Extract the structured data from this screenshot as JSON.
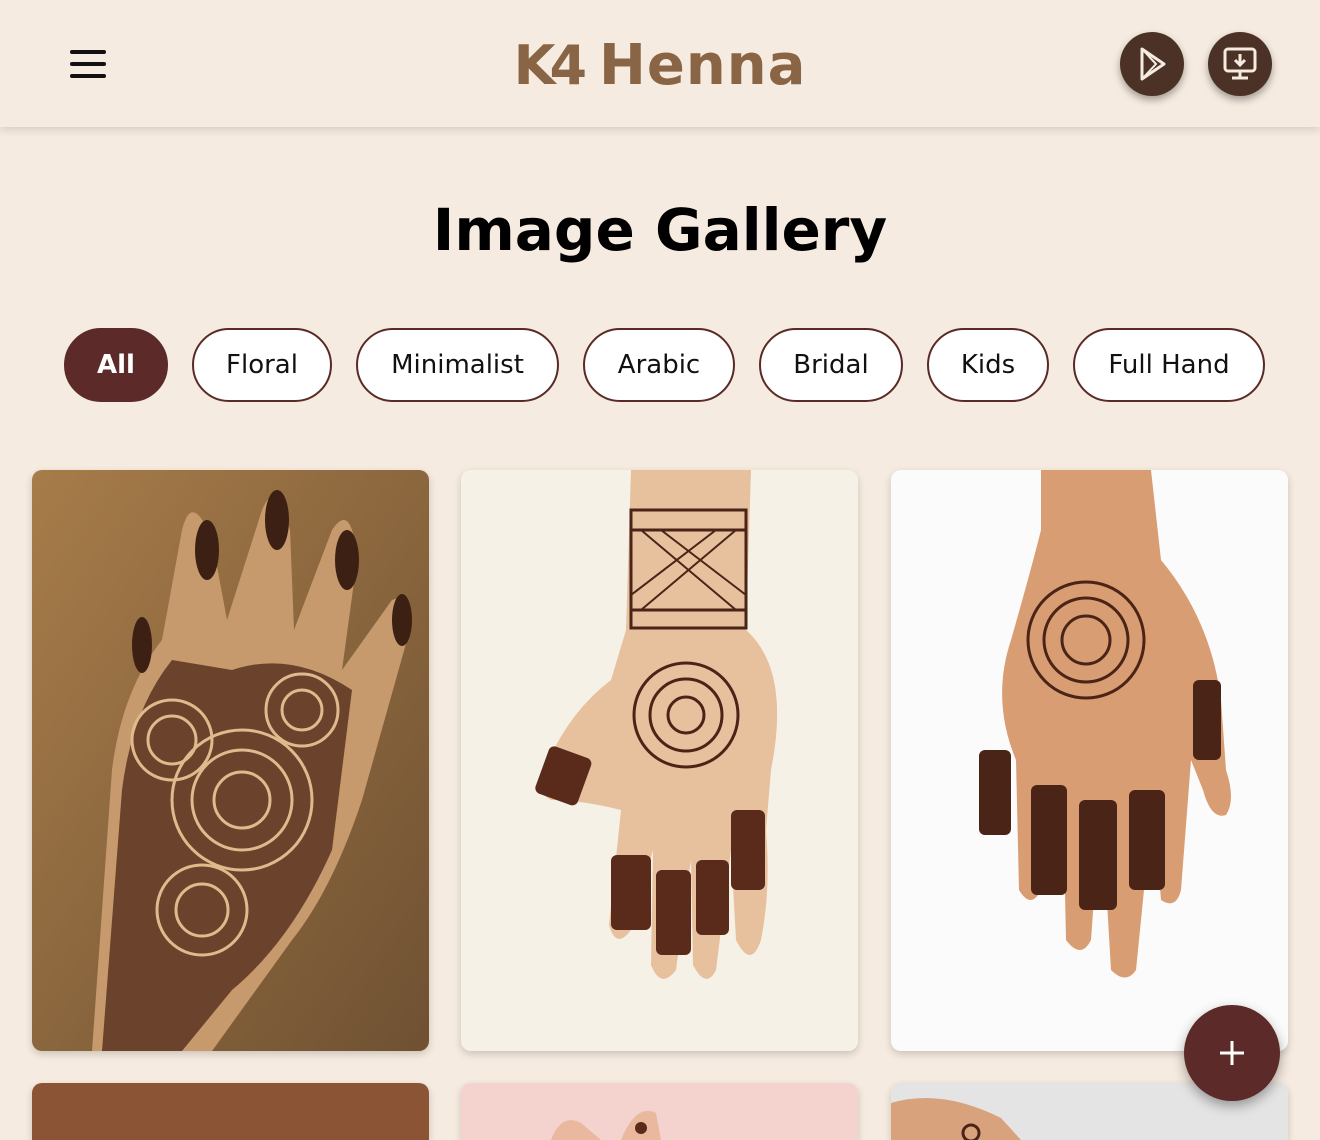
{
  "header": {
    "menu_icon": "hamburger-menu-icon",
    "logo_mark": "K4",
    "logo_word": "Henna",
    "play_store_icon": "play-store-icon",
    "download_icon": "desktop-download-icon"
  },
  "page_title": "Image Gallery",
  "filters": [
    {
      "label": "All",
      "active": true
    },
    {
      "label": "Floral",
      "active": false
    },
    {
      "label": "Minimalist",
      "active": false
    },
    {
      "label": "Arabic",
      "active": false
    },
    {
      "label": "Bridal",
      "active": false
    },
    {
      "label": "Kids",
      "active": false
    },
    {
      "label": "Full Hand",
      "active": false
    }
  ],
  "fab_icon": "plus-icon",
  "colors": {
    "background": "#f6ebe0",
    "accent": "#5c2a28",
    "logo": "#8a6545",
    "button_dark": "#4b3126"
  }
}
